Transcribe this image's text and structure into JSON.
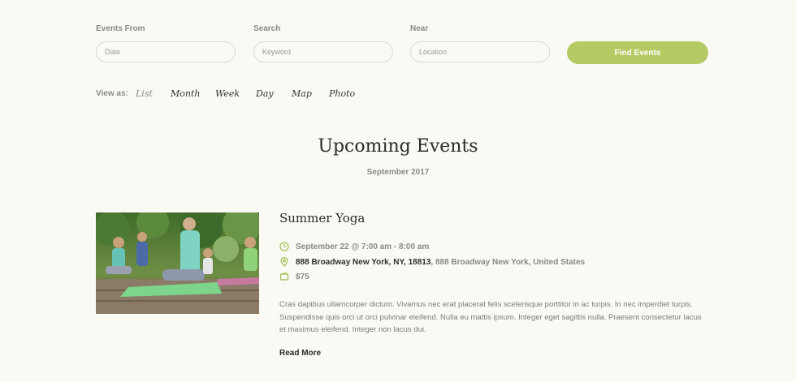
{
  "filters": {
    "events_from": {
      "label": "Events From",
      "placeholder": "Date"
    },
    "search": {
      "label": "Search",
      "placeholder": "Keyword"
    },
    "near": {
      "label": "Near",
      "placeholder": "Location"
    },
    "submit_label": "Find Events"
  },
  "view": {
    "label": "View as:",
    "tabs": [
      "List",
      "Month",
      "Week",
      "Day",
      "Map",
      "Photo"
    ],
    "active": "List"
  },
  "page": {
    "title": "Upcoming Events",
    "month": "September 2017"
  },
  "event": {
    "title": "Summer Yoga",
    "datetime": "September 22 @ 7:00 am - 8:00 am",
    "venue_name": "888 Broadway New York, NY, 18813",
    "venue_separator": ",",
    "venue_address": "888 Broadway New York, United States",
    "cost": "$75",
    "description": "Cras dapibus ullamcorper dictum. Vivamus nec erat placerat felis scelerisque porttitor in ac turpis. In nec imperdiet turpis. Suspendisse quis orci ut orci pulvinar eleifend. Nulla eu mattis ipsum. Integer eget sagittis nulla. Praesent consectetur lacus et maximus eleifend. Integer non lacus dui.",
    "read_more": "Read More"
  },
  "colors": {
    "accent": "#b5ca63",
    "background": "#fbf9f4",
    "icon": "#9bbf52"
  }
}
